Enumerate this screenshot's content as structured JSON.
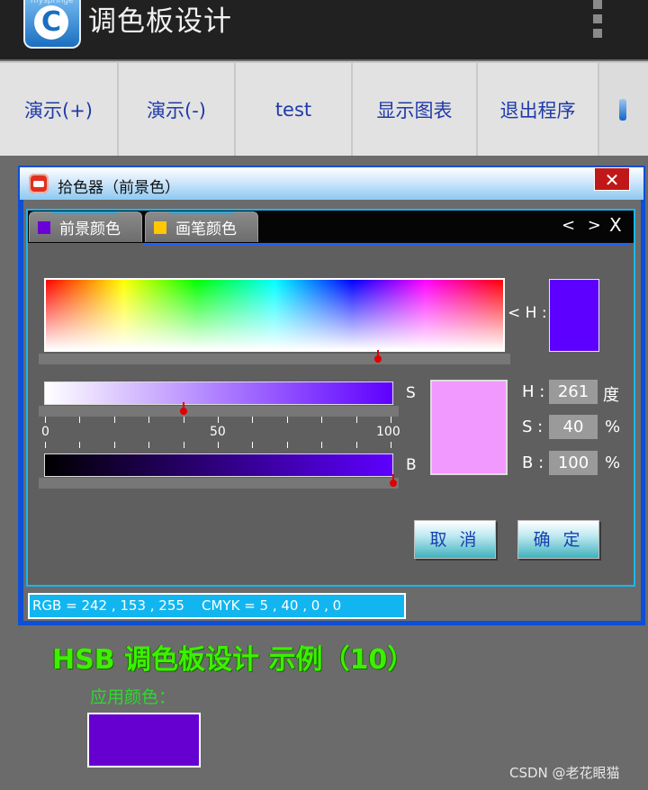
{
  "app": {
    "icon_label": "myspringe",
    "icon_letter": "C",
    "title": "调色板设计"
  },
  "toolbar": {
    "buttons": [
      "演示(+)",
      "演示(-)",
      "test",
      "显示图表",
      "退出程序"
    ]
  },
  "dialog": {
    "title": "拾色器（前景色）",
    "close": "✕",
    "tabs": [
      {
        "label": "前景颜色",
        "color": "#6a00d8"
      },
      {
        "label": "画笔颜色",
        "color": "#ffc800"
      }
    ],
    "tab_nav": "< >",
    "tab_close": "X",
    "hue_label": "< H :",
    "hue_color": "#5e00ff",
    "s_label": "S",
    "b_label": "B",
    "scale_labels": [
      "0",
      "50",
      "100"
    ],
    "preview_color": "#f299ff",
    "slider_levels": {
      "hue_fraction": 0.725,
      "saturation_percent": 40,
      "brightness_percent": 100
    },
    "fields": {
      "h_label": "H :",
      "h_value": "261",
      "h_unit": "度",
      "s_label": "S :",
      "s_value": "40",
      "s_unit": "%",
      "b_label": "B :",
      "b_value": "100",
      "b_unit": "%"
    },
    "cancel_button": "取 消",
    "ok_button": "确 定",
    "status": "RGB = 242 , 153 , 255    CMYK = 5 , 40 , 0 , 0"
  },
  "demo": {
    "title": "HSB 调色板设计  示例（10）",
    "applied_label": "应用颜色：",
    "applied_color": "#6600d0"
  },
  "watermark": "CSDN @老花眼猫"
}
